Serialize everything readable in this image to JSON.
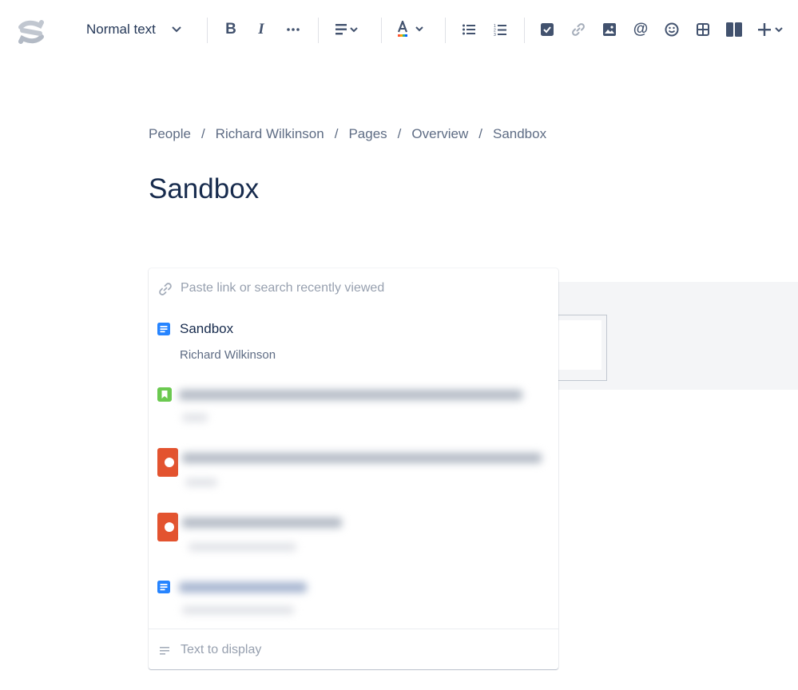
{
  "toolbar": {
    "text_style": "Normal text",
    "icons": [
      "confluence-logo",
      "chevron-down-icon",
      "bold-icon",
      "italic-icon",
      "more-icon",
      "align-icon",
      "text-color-icon",
      "bullet-list-icon",
      "numbered-list-icon",
      "task-icon",
      "link-icon",
      "image-icon",
      "mention-icon",
      "emoji-icon",
      "table-icon",
      "layout-icon",
      "insert-icon"
    ]
  },
  "breadcrumb": [
    "People",
    "Richard Wilkinson",
    "Pages",
    "Overview",
    "Sandbox"
  ],
  "breadcrumb_separator": "/",
  "page": {
    "title": "Sandbox"
  },
  "link_popup": {
    "search_placeholder": "Paste link or search recently viewed",
    "search_value": "",
    "first_result": {
      "title": "Sandbox",
      "subtitle": "Richard Wilkinson",
      "icon": "page-icon"
    },
    "blurred_result_icons": [
      "blog-icon",
      "record-icon",
      "record-icon",
      "page-icon"
    ],
    "text_display_placeholder": "Text to display",
    "text_display_value": ""
  },
  "colors": {
    "page_icon": "#2684ff",
    "blog_icon": "#6bc950",
    "record_icon": "#de350b",
    "text_primary": "#172b4d",
    "text_secondary": "#5e6c84"
  }
}
